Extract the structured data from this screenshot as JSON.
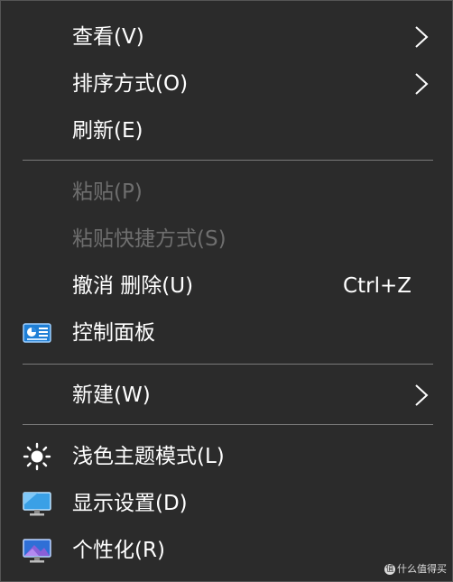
{
  "menu": {
    "items": [
      {
        "label": "查看(V)",
        "submenu": true,
        "enabled": true
      },
      {
        "label": "排序方式(O)",
        "submenu": true,
        "enabled": true
      },
      {
        "label": "刷新(E)",
        "enabled": true
      },
      {
        "label": "粘贴(P)",
        "enabled": false
      },
      {
        "label": "粘贴快捷方式(S)",
        "enabled": false
      },
      {
        "label": "撤消 删除(U)",
        "shortcut": "Ctrl+Z",
        "enabled": true
      },
      {
        "label": "控制面板",
        "icon": "control-panel-icon",
        "enabled": true
      },
      {
        "label": "新建(W)",
        "submenu": true,
        "enabled": true
      },
      {
        "label": "浅色主题模式(L)",
        "icon": "sun-icon",
        "enabled": true
      },
      {
        "label": "显示设置(D)",
        "icon": "monitor-icon",
        "enabled": true
      },
      {
        "label": "个性化(R)",
        "icon": "personalize-monitor-icon",
        "enabled": true
      }
    ]
  },
  "watermark": {
    "text": "什么值得买"
  },
  "colors": {
    "background": "#2b2b2b",
    "text": "#ffffff",
    "disabled_text": "#6e6e6e",
    "separator": "#7a7a7a"
  }
}
